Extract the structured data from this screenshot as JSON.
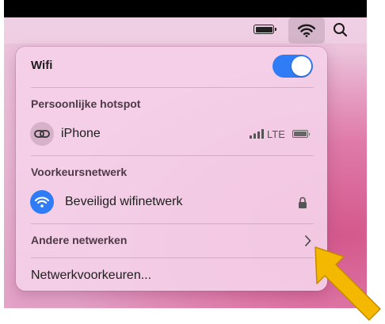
{
  "menubar": {
    "battery_icon": "battery-full-icon",
    "wifi_icon": "wifi-icon",
    "search_icon": "magnifying-glass-icon"
  },
  "wifi_panel": {
    "title": "Wifi",
    "toggle_state": "on",
    "accent_color": "#2f7cf6",
    "hotspot_section": "Persoonlijke hotspot",
    "hotspot": {
      "name": "iPhone",
      "network_type": "LTE",
      "icon": "link-icon"
    },
    "preferred_section": "Voorkeursnetwerk",
    "preferred_network": {
      "name": "Beveiligd wifinetwerk",
      "icon": "wifi-icon",
      "secured_icon": "lock-icon"
    },
    "other_networks_label": "Andere netwerken",
    "preferences_label": "Netwerkvoorkeuren..."
  },
  "annotation": {
    "arrow_color": "#f5b800",
    "arrow_icon": "callout-arrow-icon"
  }
}
